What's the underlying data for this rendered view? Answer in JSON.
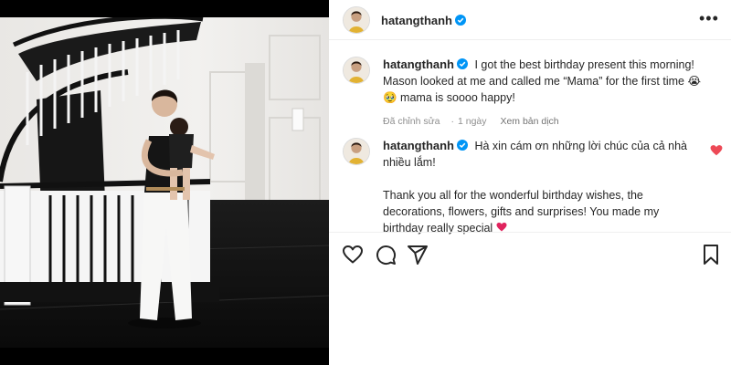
{
  "post": {
    "author": "hatangthanh",
    "verified": true,
    "more_label": "•••"
  },
  "caption": {
    "username": "hatangthanh",
    "text": "I got the best birthday present this morning! Mason looked at me and called me “Mama” for the first time 😭 🥹 mama is soooo happy!",
    "edited_label": "Đã chỉnh sửa",
    "time": "1 ngày",
    "translate_label": "Xem bản dịch"
  },
  "comments": [
    {
      "username": "hatangthanh",
      "line1": "Hà xin cám ơn những lời chúc của cả nhà nhiều lắm!",
      "line2": "Thank you all for the wonderful birthday wishes, the decorations, flowers, gifts and surprises! You made my birthday really special"
    }
  ],
  "icons": {
    "more": "more-icon",
    "like": "heart-icon",
    "comment": "comment-icon",
    "share": "share-icon",
    "save": "bookmark-icon",
    "verified": "verified-badge-icon"
  },
  "colors": {
    "verified_blue": "#0095f6",
    "heart_red": "#ed4956",
    "text": "#262626",
    "secondary": "#8e8e8e"
  }
}
